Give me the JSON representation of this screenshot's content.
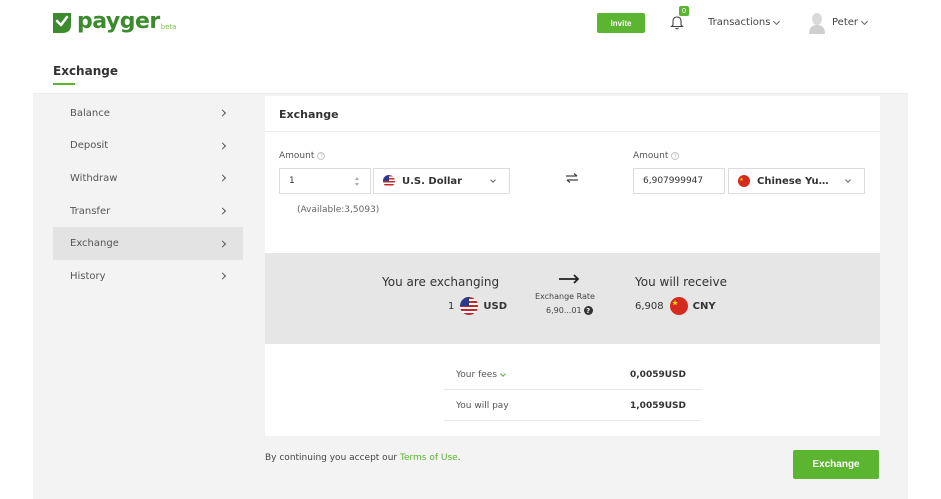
{
  "header": {
    "logo_text": "payger",
    "logo_badge": "beta",
    "invite_label": "Invite",
    "notification_count": "0",
    "transactions_label": "Transactions",
    "user_name": "Peter"
  },
  "page": {
    "title": "Exchange"
  },
  "sidebar": {
    "items": [
      {
        "label": "Balance"
      },
      {
        "label": "Deposit"
      },
      {
        "label": "Withdraw"
      },
      {
        "label": "Transfer"
      },
      {
        "label": "Exchange",
        "active": true
      },
      {
        "label": "History"
      }
    ]
  },
  "exchange_form": {
    "title": "Exchange",
    "from": {
      "label": "Amount",
      "amount": "1",
      "currency": "U.S. Dollar",
      "available": "(Available:3,5093)"
    },
    "to": {
      "label": "Amount",
      "amount": "6,907999947",
      "currency": "Chinese Yu…"
    }
  },
  "summary": {
    "exchanging_title": "You are exchanging",
    "exchanging_amount": "1",
    "exchanging_currency": "USD",
    "rate_label": "Exchange Rate",
    "rate_value": "6,90...01",
    "receive_title": "You will receive",
    "receive_amount": "6,908",
    "receive_currency": "CNY"
  },
  "fees": {
    "fees_label": "Your fees",
    "fees_value": "0,0059USD",
    "pay_label": "You will pay",
    "pay_value": "1,0059USD"
  },
  "footer": {
    "terms_prefix": "By continuing you accept our",
    "terms_link": "Terms of Use",
    "terms_suffix": ".",
    "exchange_button": "Exchange"
  },
  "colors": {
    "brand_green": "#5cb531",
    "logo_green": "#3c8a2e"
  }
}
